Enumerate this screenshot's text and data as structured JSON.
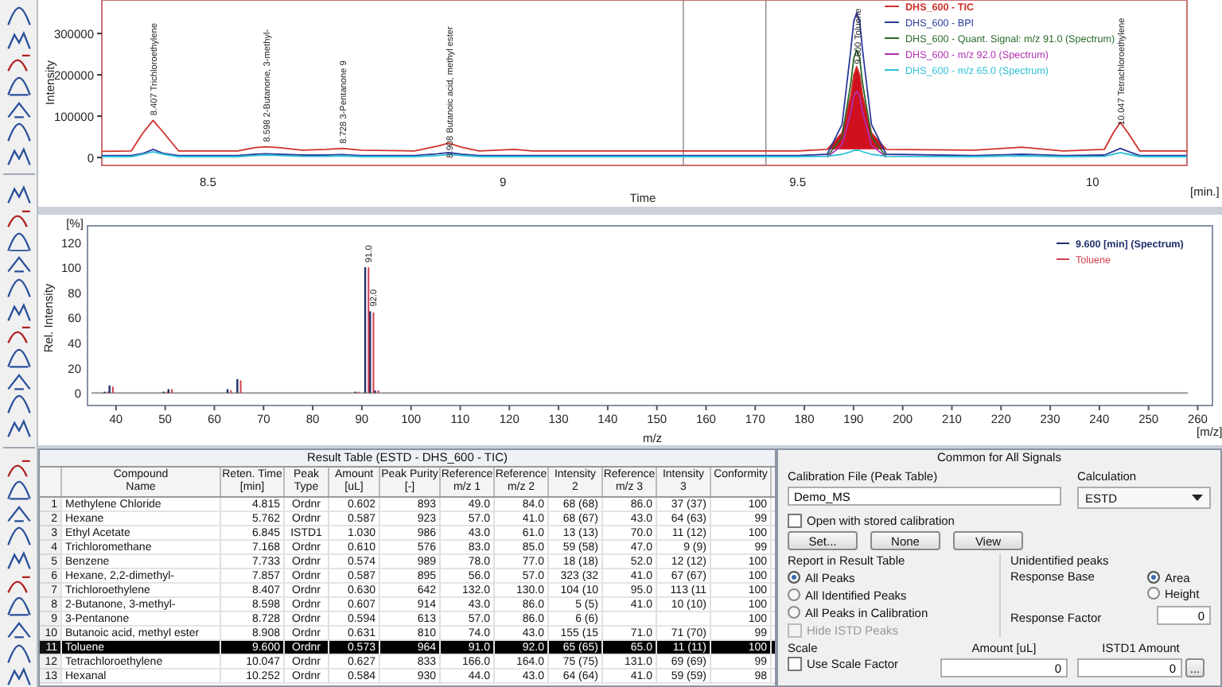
{
  "chromatogram": {
    "x_unit": "[min.]",
    "chart_data": {
      "type": "line",
      "xlabel": "Time",
      "ylabel": "Intensity",
      "xlim": [
        8.32,
        10.16
      ],
      "ylim": [
        -19000,
        381000
      ],
      "xticks": [
        8.5,
        9.0,
        9.5,
        10.0
      ],
      "yticks": [
        {
          "value": 0,
          "label": "0"
        },
        {
          "value": 100000,
          "label": "100000"
        },
        {
          "value": 200000,
          "label": "200000"
        },
        {
          "value": 300000,
          "label": "300000"
        }
      ],
      "legend": "upper right",
      "ref_lines": [
        {
          "axis": "x",
          "value": 9.306
        },
        {
          "axis": "x",
          "value": 9.446
        }
      ],
      "x": [
        8.32,
        8.37,
        8.39,
        8.407,
        8.425,
        8.45,
        8.55,
        8.58,
        8.598,
        8.62,
        8.66,
        8.7,
        8.728,
        8.76,
        8.85,
        8.89,
        8.908,
        8.93,
        8.96,
        9.02,
        9.05,
        9.5,
        9.55,
        9.575,
        9.59,
        9.595,
        9.6,
        9.605,
        9.61,
        9.625,
        9.65,
        9.8,
        9.88,
        9.95,
        10.02,
        10.035,
        10.047,
        10.06,
        10.08,
        10.16
      ],
      "series": [
        {
          "name": "DHS_600 - TIC",
          "color": "#d0302a",
          "values": [
            15000,
            16000,
            60000,
            90000,
            60000,
            16000,
            16000,
            24000,
            26000,
            24000,
            18000,
            20000,
            22000,
            18000,
            16000,
            28000,
            35000,
            25000,
            16000,
            20000,
            16000,
            16000,
            20000,
            60000,
            150000,
            200000,
            220000,
            200000,
            150000,
            60000,
            20000,
            18000,
            25000,
            16000,
            20000,
            60000,
            85000,
            60000,
            16000,
            16000
          ]
        },
        {
          "name": "DHS_600 - BPI",
          "color": "#2a3a9a",
          "values": [
            5000,
            5000,
            10000,
            20000,
            10000,
            5000,
            5000,
            8000,
            9000,
            8000,
            6000,
            6000,
            7000,
            5000,
            5000,
            9000,
            12000,
            8000,
            5000,
            5000,
            5000,
            5000,
            8000,
            80000,
            260000,
            330000,
            350000,
            330000,
            260000,
            80000,
            8000,
            5000,
            8000,
            5000,
            6000,
            15000,
            22000,
            15000,
            5000,
            5000
          ]
        },
        {
          "name": "DHS_600 - Quant. Signal: m/z 91.0 (Spectrum)",
          "color": "#2a6a2a",
          "values": [
            null,
            null,
            null,
            null,
            null,
            null,
            null,
            null,
            null,
            null,
            null,
            null,
            null,
            null,
            null,
            null,
            null,
            null,
            null,
            null,
            null,
            null,
            2000,
            50000,
            180000,
            240000,
            260000,
            240000,
            180000,
            50000,
            2000,
            null,
            null,
            null,
            null,
            null,
            null,
            null,
            null,
            null
          ]
        },
        {
          "name": "DHS_600 - m/z 92.0 (Spectrum)",
          "color": "#b030b0",
          "values": [
            null,
            null,
            null,
            null,
            null,
            null,
            null,
            null,
            null,
            null,
            null,
            null,
            null,
            null,
            null,
            null,
            null,
            null,
            null,
            null,
            null,
            null,
            1000,
            30000,
            110000,
            150000,
            160000,
            150000,
            110000,
            30000,
            1000,
            null,
            null,
            null,
            null,
            null,
            null,
            null,
            null,
            null
          ]
        },
        {
          "name": "DHS_600 - m/z 65.0 (Spectrum)",
          "color": "#30c0d8",
          "values": [
            2000,
            2000,
            8000,
            14000,
            8000,
            2000,
            2000,
            5000,
            6000,
            5000,
            3000,
            3000,
            4000,
            2000,
            2000,
            5000,
            7000,
            5000,
            2000,
            2000,
            2000,
            2000,
            3000,
            8000,
            14000,
            17000,
            18000,
            17000,
            14000,
            8000,
            3000,
            2000,
            4000,
            2000,
            3000,
            8000,
            12000,
            8000,
            2000,
            2000
          ]
        }
      ],
      "annotations": [
        {
          "x": 8.407,
          "y": 90000,
          "text": "8.407 Trichloroethylene"
        },
        {
          "x": 8.598,
          "y": 26000,
          "text": "8.598 2-Butanone, 3-methyl-"
        },
        {
          "x": 8.728,
          "y": 22000,
          "text": "8.728 3-Pentanone 9"
        },
        {
          "x": 8.908,
          "y": 35000,
          "text": "8.908 Butanoic acid, methyl ester"
        },
        {
          "x": 9.6,
          "y": 220000,
          "text": "9.600 Toluene"
        },
        {
          "x": 10.047,
          "y": 85000,
          "text": "10.047 Tetrachloroethylene"
        }
      ]
    }
  },
  "spectrum": {
    "y_unit": "[%]",
    "x_unit": "[m/z]",
    "chart_data": {
      "type": "bar",
      "stacked": false,
      "legend": "upper right",
      "xlabel": "m/z",
      "ylabel": "Rel. Intensity",
      "xlim": [
        34.2,
        263
      ],
      "ylim": [
        -10,
        133
      ],
      "xticks": [
        40,
        50,
        60,
        70,
        80,
        90,
        100,
        110,
        120,
        130,
        140,
        150,
        160,
        170,
        180,
        190,
        200,
        210,
        220,
        230,
        240,
        250,
        260
      ],
      "yticks": [
        0,
        20,
        40,
        60,
        80,
        100,
        120
      ],
      "x": [
        38,
        39,
        50,
        51,
        63,
        65,
        89,
        91,
        92,
        93
      ],
      "series": [
        {
          "name": "9.600 [min] (Spectrum)",
          "color": "#1f2f6a",
          "values": [
            1,
            6,
            1,
            3,
            3,
            11,
            1,
            100,
            65,
            2
          ]
        },
        {
          "name": "Toluene",
          "color": "#d04050",
          "values": [
            1,
            5,
            1,
            3,
            2,
            10,
            1,
            100,
            64,
            2
          ]
        }
      ],
      "annotations": [
        {
          "x": 91,
          "y": 100,
          "text": "91.0"
        },
        {
          "x": 92,
          "y": 65,
          "text": "92.0"
        }
      ]
    }
  },
  "result_table": {
    "title": "Result Table (ESTD - DHS_600 - TIC)",
    "columns": [
      "",
      "Compound\nName",
      "Reten. Time\n[min]",
      "Peak\nType",
      "Amount\n[uL]",
      "Peak Purity\n[-]",
      "Reference\nm/z 1",
      "Reference\nm/z 2",
      "Intensity\n2",
      "Reference\nm/z 3",
      "Intensity\n3",
      "Conformity"
    ],
    "rows": [
      {
        "selected": false,
        "cells": [
          "1",
          "Methylene Chloride",
          "4.815",
          "Ordnr",
          "0.602",
          "893",
          "49.0",
          "84.0",
          "68 (68)",
          "86.0",
          "37 (37)",
          "100"
        ]
      },
      {
        "selected": false,
        "cells": [
          "2",
          "Hexane",
          "5.762",
          "Ordnr",
          "0.587",
          "923",
          "57.0",
          "41.0",
          "68 (67)",
          "43.0",
          "64 (63)",
          "99"
        ]
      },
      {
        "selected": false,
        "cells": [
          "3",
          "Ethyl Acetate",
          "6.845",
          "ISTD1",
          "1.030",
          "986",
          "43.0",
          "61.0",
          "13 (13)",
          "70.0",
          "11 (12)",
          "100"
        ]
      },
      {
        "selected": false,
        "cells": [
          "4",
          "Trichloromethane",
          "7.168",
          "Ordnr",
          "0.610",
          "576",
          "83.0",
          "85.0",
          "59 (58)",
          "47.0",
          "9 (9)",
          "99"
        ]
      },
      {
        "selected": false,
        "cells": [
          "5",
          "Benzene",
          "7.733",
          "Ordnr",
          "0.574",
          "989",
          "78.0",
          "77.0",
          "18 (18)",
          "52.0",
          "12 (12)",
          "100"
        ]
      },
      {
        "selected": false,
        "cells": [
          "6",
          "Hexane, 2,2-dimethyl-",
          "7.857",
          "Ordnr",
          "0.587",
          "895",
          "56.0",
          "57.0",
          "323 (32",
          "41.0",
          "67 (67)",
          "100"
        ]
      },
      {
        "selected": false,
        "cells": [
          "7",
          "Trichloroethylene",
          "8.407",
          "Ordnr",
          "0.630",
          "642",
          "132.0",
          "130.0",
          "104 (10",
          "95.0",
          "113 (11",
          "100"
        ]
      },
      {
        "selected": false,
        "cells": [
          "8",
          "2-Butanone, 3-methyl-",
          "8.598",
          "Ordnr",
          "0.607",
          "914",
          "43.0",
          "86.0",
          "5 (5)",
          "41.0",
          "10 (10)",
          "100"
        ]
      },
      {
        "selected": false,
        "cells": [
          "9",
          "3-Pentanone",
          "8.728",
          "Ordnr",
          "0.594",
          "613",
          "57.0",
          "86.0",
          "6 (6)",
          null,
          null,
          "100"
        ]
      },
      {
        "selected": false,
        "cells": [
          "10",
          "Butanoic acid, methyl ester",
          "8.908",
          "Ordnr",
          "0.631",
          "810",
          "74.0",
          "43.0",
          "155 (15",
          "71.0",
          "71 (70)",
          "99"
        ]
      },
      {
        "selected": true,
        "cells": [
          "11",
          "Toluene",
          "9.600",
          "Ordnr",
          "0.573",
          "964",
          "91.0",
          "92.0",
          "65 (65)",
          "65.0",
          "11 (11)",
          "100"
        ]
      },
      {
        "selected": false,
        "cells": [
          "12",
          "Tetrachloroethylene",
          "10.047",
          "Ordnr",
          "0.627",
          "833",
          "166.0",
          "164.0",
          "75 (75)",
          "131.0",
          "69 (69)",
          "99"
        ]
      },
      {
        "selected": false,
        "cells": [
          "13",
          "Hexanal",
          "10.252",
          "Ordnr",
          "0.584",
          "930",
          "44.0",
          "43.0",
          "64 (64)",
          "41.0",
          "59 (59)",
          "98"
        ]
      }
    ]
  },
  "settings": {
    "title": "Common for All Signals",
    "calibration_label": "Calibration File (Peak Table)",
    "calibration_file": "Demo_MS",
    "calculation_label": "Calculation",
    "calculation": "ESTD",
    "open_stored": {
      "label": "Open with stored calibration",
      "checked": false
    },
    "buttons": [
      "Set...",
      "None",
      "View"
    ],
    "report": {
      "title": "Report in Result Table",
      "options": [
        {
          "label": "All Peaks",
          "selected": true
        },
        {
          "label": "All Identified Peaks",
          "selected": false
        },
        {
          "label": "All Peaks in Calibration",
          "selected": false
        }
      ],
      "hide_istd": {
        "label": "Hide ISTD Peaks",
        "checked": false,
        "disabled": true
      }
    },
    "unidentified": {
      "title": "Unidentified peaks",
      "response_base_label": "Response Base",
      "options": [
        {
          "label": "Area",
          "selected": true
        },
        {
          "label": "Height",
          "selected": false
        }
      ],
      "response_factor_label": "Response Factor",
      "response_factor": "0"
    },
    "scale": {
      "title": "Scale",
      "use_scale": {
        "label": "Use Scale Factor",
        "checked": false
      },
      "amount_label": "Amount [uL]",
      "amount": "0",
      "istd_label": "ISTD1 Amount",
      "istd_amount": "0",
      "browse_button": "..."
    }
  }
}
